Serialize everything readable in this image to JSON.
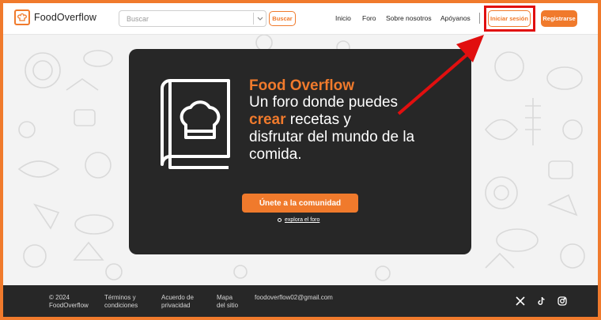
{
  "header": {
    "brand": "FoodOverflow",
    "search": {
      "placeholder": "Buscar",
      "button_label": "Buscar"
    },
    "nav": [
      "Inicio",
      "Foro",
      "Sobre nosotros",
      "Apóyanos"
    ],
    "login_label": "Iniciar sesión",
    "register_label": "Registrarse"
  },
  "hero": {
    "title": "Food Overflow",
    "tagline_line1": "Un foro donde puedes",
    "tagline_accent": "crear",
    "tagline_line2_rest": " recetas y",
    "tagline_line3": "disfrutar del mundo de la",
    "tagline_line4": "comida.",
    "cta_label": "Únete a la comunidad",
    "explore_label": "explora el foro"
  },
  "footer": {
    "copyright_line1": "© 2024",
    "copyright_line2": "FoodOverflow",
    "terms_line1": "Términos y",
    "terms_line2": "condiciones",
    "privacy_line1": "Acuerdo de",
    "privacy_line2": "privacidad",
    "sitemap_line1": "Mapa",
    "sitemap_line2": "del sitio",
    "email": "foodoverflow02@gmail.com"
  },
  "colors": {
    "accent": "#f07a2c",
    "dark": "#272727",
    "annotation_red": "#e10f0f"
  },
  "icons": [
    "chef-hat-logo-icon",
    "chevron-down-icon",
    "book-chef-hat-icon",
    "x-social-icon",
    "tiktok-icon",
    "instagram-icon"
  ]
}
